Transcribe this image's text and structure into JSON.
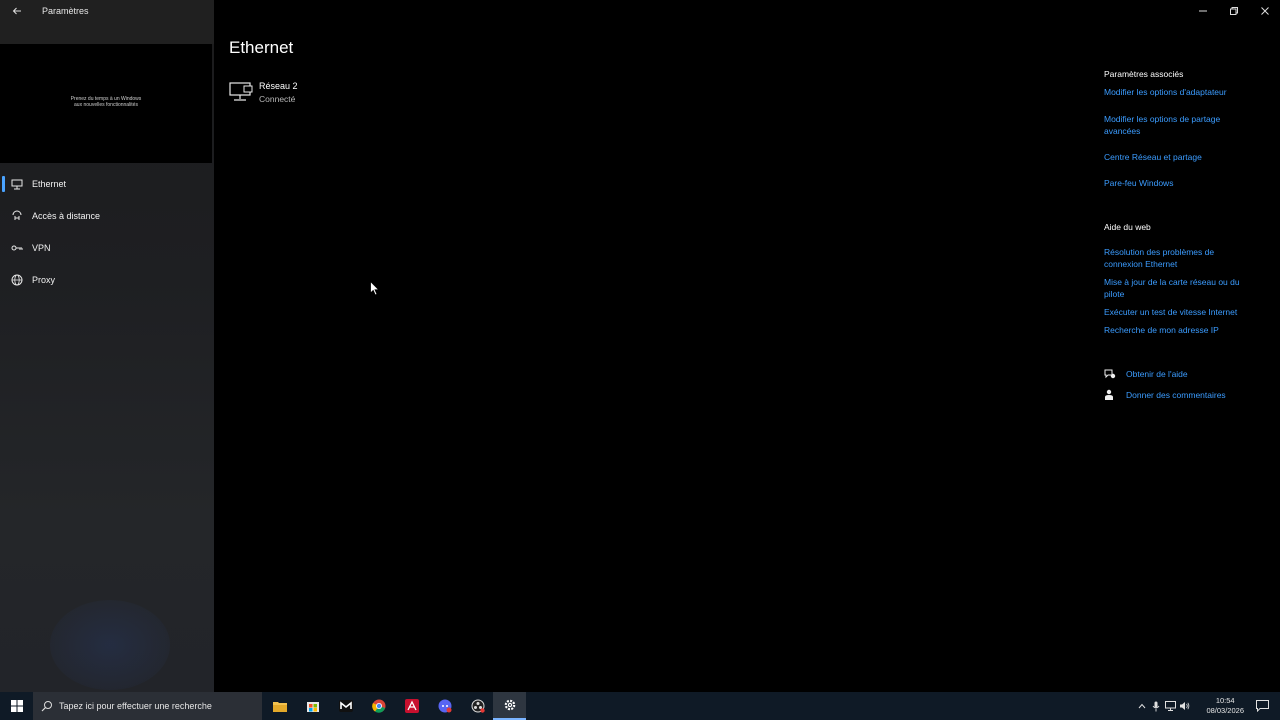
{
  "window": {
    "title": "Paramètres",
    "back_icon": "back-arrow-icon",
    "controls": [
      "minimize-icon",
      "restore-icon",
      "close-icon"
    ]
  },
  "user_card": {
    "text": "Prenez du temps à un Windows aux nouvelles fonctionnalités"
  },
  "sidebar": {
    "items": [
      {
        "label": "Ethernet",
        "icon": "ethernet-icon",
        "active": true
      },
      {
        "label": "Accès à distance",
        "icon": "dialup-icon",
        "active": false
      },
      {
        "label": "VPN",
        "icon": "vpn-icon",
        "active": false
      },
      {
        "label": "Proxy",
        "icon": "globe-icon",
        "active": false
      }
    ]
  },
  "main": {
    "title": "Ethernet",
    "network": {
      "name": "Réseau 2",
      "status": "Connecté",
      "icon": "network-monitor-icon"
    }
  },
  "related": {
    "heading": "Paramètres associés",
    "links": [
      "Modifier les options d'adaptateur",
      "Modifier les options de partage avancées",
      "Centre Réseau et partage",
      "Pare-feu Windows"
    ],
    "web_heading": "Aide du web",
    "web_links": [
      "Résolution des problèmes de connexion Ethernet",
      "Mise à jour de la carte réseau ou du pilote",
      "Exécuter un test de vitesse Internet",
      "Recherche de mon adresse IP"
    ],
    "help": [
      {
        "label": "Obtenir de l'aide",
        "icon": "help-chat-icon"
      },
      {
        "label": "Donner des commentaires",
        "icon": "feedback-icon"
      }
    ]
  },
  "taskbar": {
    "search_placeholder": "Tapez ici pour effectuer une recherche",
    "apps": [
      "file-explorer-icon",
      "store-icon",
      "app-icon",
      "chrome-icon",
      "acrobat-icon",
      "discord-icon",
      "obs-icon",
      "settings-icon"
    ],
    "time": "10:54",
    "date": "08/03/2026"
  },
  "colors": {
    "accent": "#3b9cff",
    "taskbar": "#0f1a26",
    "background": "#000000"
  }
}
